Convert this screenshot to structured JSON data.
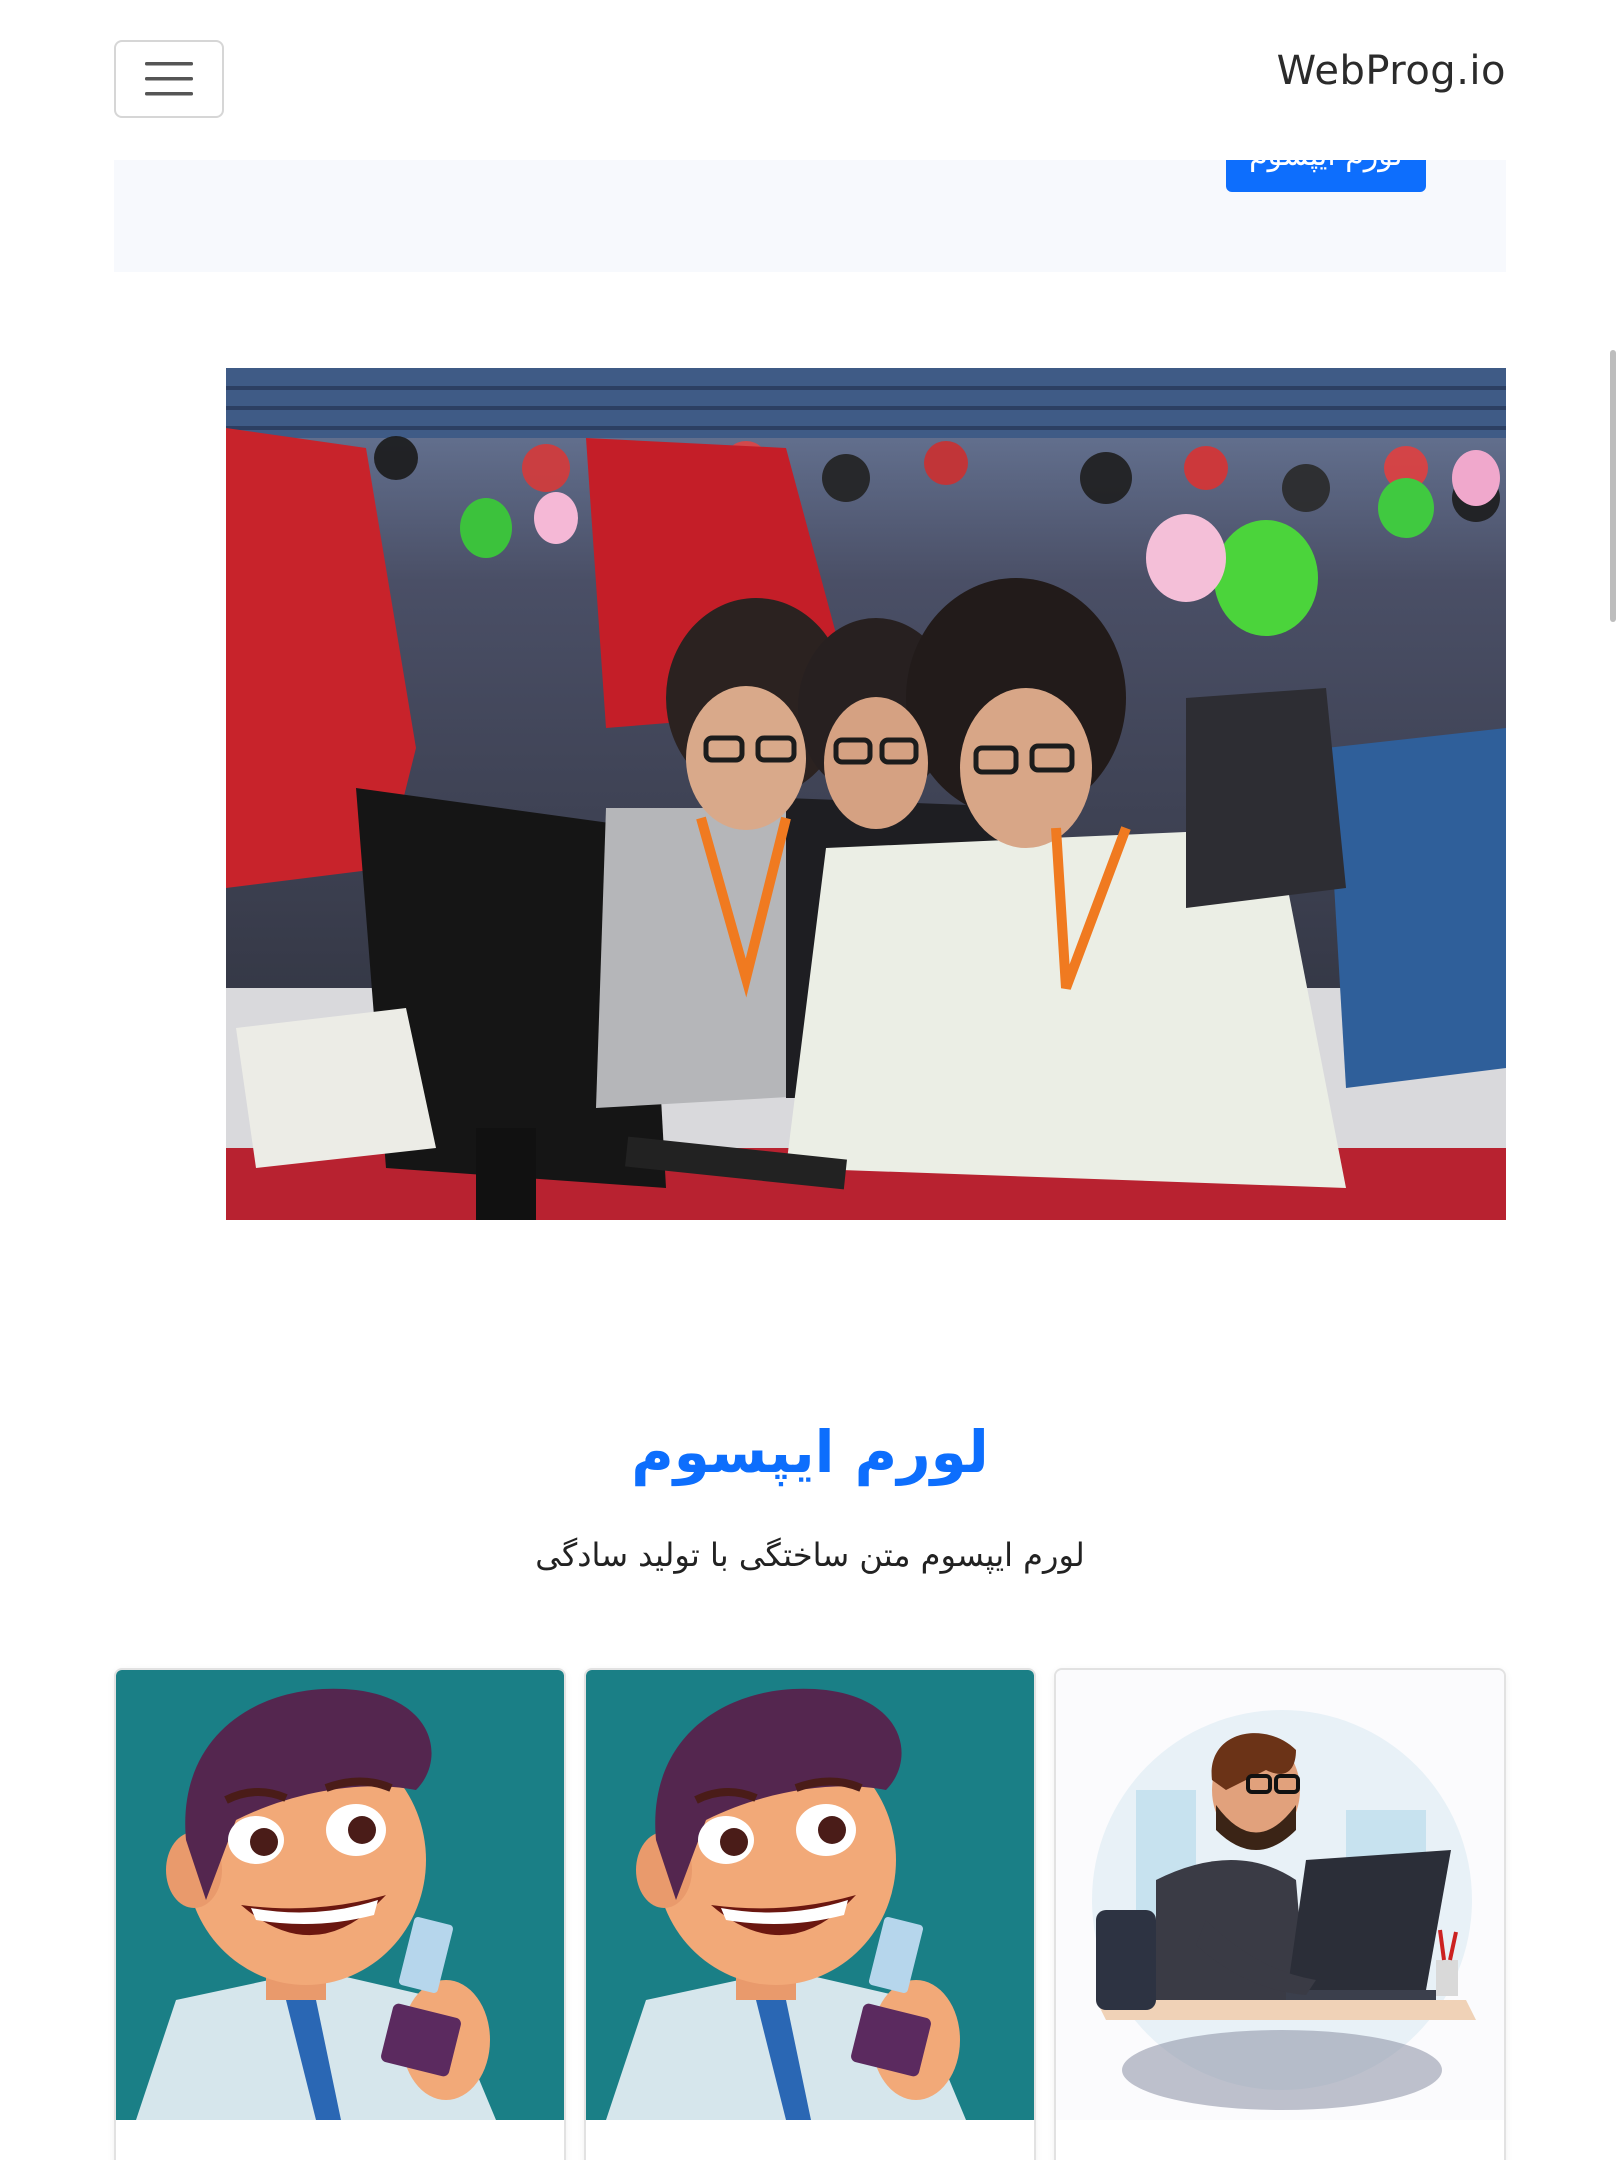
{
  "navbar": {
    "brand": "WebProg.io",
    "toggler_icon": "hamburger-menu-icon"
  },
  "hero": {
    "button_label": "لورم ایپسوم"
  },
  "section": {
    "title": "لورم ایپسوم",
    "subtitle": "لورم ایپسوم متن ساختگی با تولید سادگی"
  },
  "colors": {
    "primary": "#0d6efd",
    "hero_bg": "#f7f9fd",
    "card_teal": "#1a7f86"
  }
}
